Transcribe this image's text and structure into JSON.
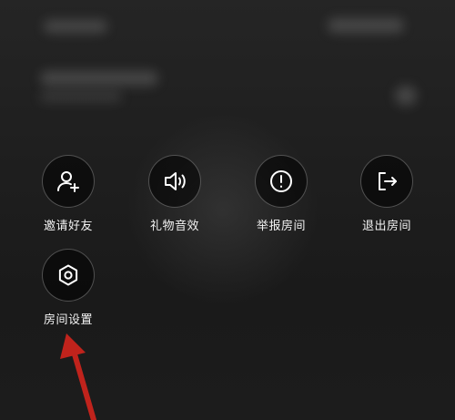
{
  "menu": {
    "items": [
      {
        "label": "邀请好友",
        "icon": "add-user-icon"
      },
      {
        "label": "礼物音效",
        "icon": "speaker-icon"
      },
      {
        "label": "举报房间",
        "icon": "alert-circle-icon"
      },
      {
        "label": "退出房间",
        "icon": "exit-icon"
      },
      {
        "label": "房间设置",
        "icon": "hexagon-settings-icon"
      }
    ]
  },
  "colors": {
    "background": "#1e1e1e",
    "icon_stroke": "#ffffff",
    "label_text": "#f2f2f2",
    "annotation_arrow": "#c0231c"
  }
}
